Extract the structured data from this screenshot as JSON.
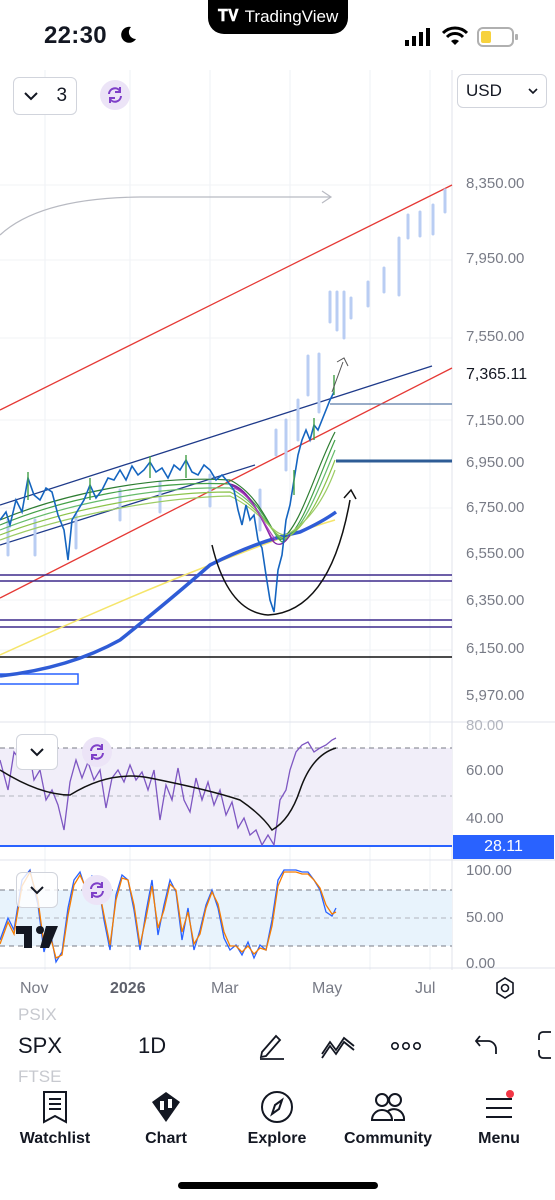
{
  "status_bar": {
    "time": "22:30",
    "app_pill": "TradingView"
  },
  "chart_controls": {
    "layout_count": "3",
    "currency": "USD"
  },
  "price_axis": {
    "labels": [
      "8,350.00",
      "7,950.00",
      "7,550.00",
      "7,150.00",
      "6,950.00",
      "6,750.00",
      "6,550.00",
      "6,350.00",
      "6,150.00",
      "5,970.00"
    ],
    "current_price": "7,365.11"
  },
  "rsi_axis": {
    "labels": [
      "80.00",
      "60.00",
      "40.00"
    ],
    "current_value": "28.11"
  },
  "stoch_axis": {
    "labels": [
      "100.00",
      "50.00",
      "0.00"
    ]
  },
  "time_axis": {
    "labels": [
      "Nov",
      "2026",
      "Mar",
      "May",
      "Jul"
    ]
  },
  "symbol_toolbar": {
    "symbol": "SPX",
    "interval": "1D"
  },
  "ghost_symbols": [
    "PSIX",
    "FTSE"
  ],
  "bottom_nav": {
    "items": [
      {
        "label": "Watchlist",
        "icon": "watchlist-icon"
      },
      {
        "label": "Chart",
        "icon": "chart-icon"
      },
      {
        "label": "Explore",
        "icon": "compass-icon"
      },
      {
        "label": "Community",
        "icon": "community-icon"
      },
      {
        "label": "Menu",
        "icon": "menu-icon"
      }
    ]
  },
  "colors": {
    "accent": "#2962ff",
    "channel_red": "#e53935",
    "channel_blue": "#1e3a8a",
    "notification": "#f23645"
  }
}
